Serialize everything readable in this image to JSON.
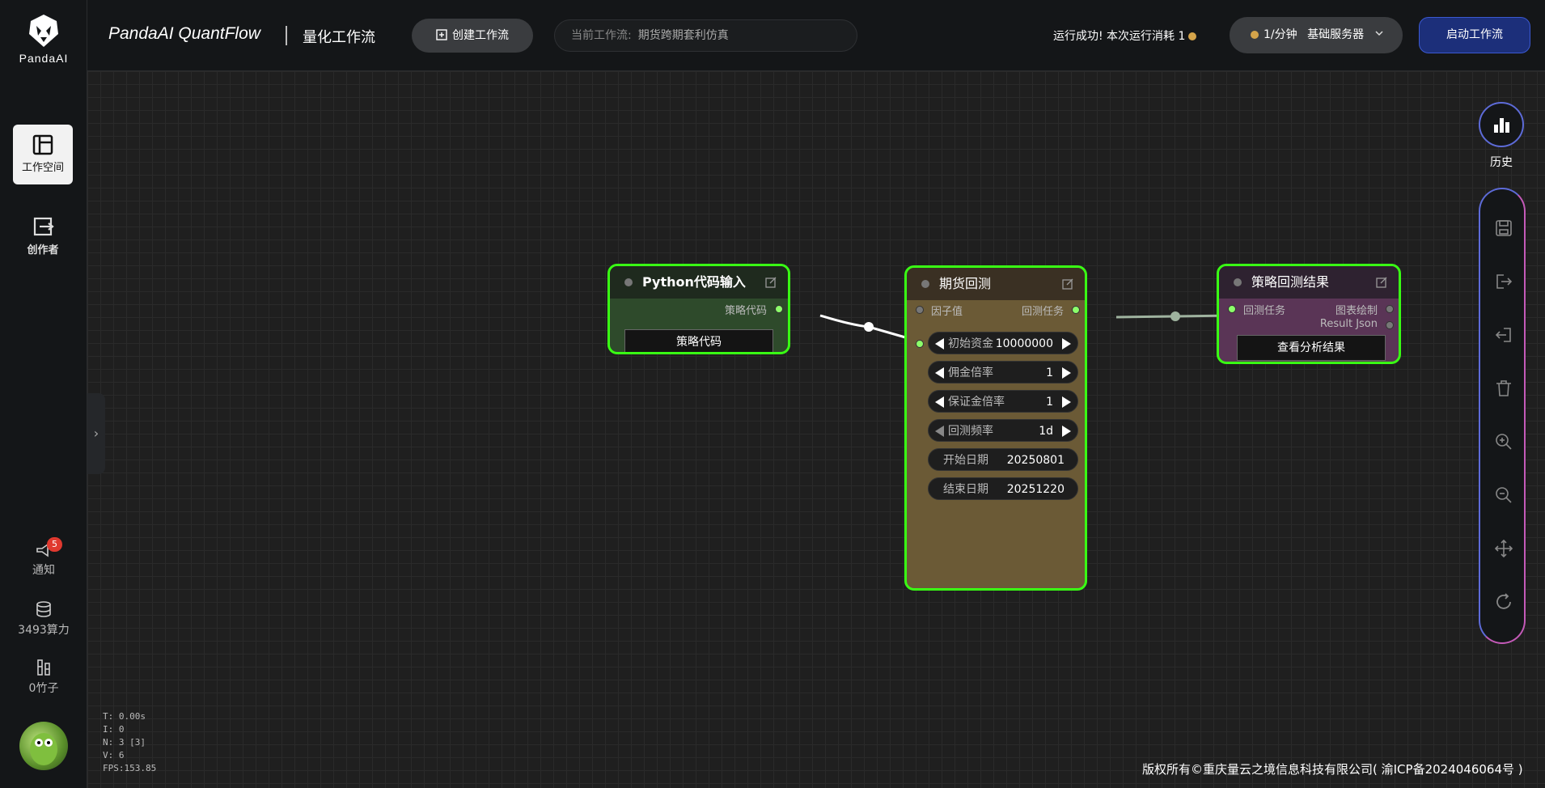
{
  "app": {
    "logo_text": "PandaAI",
    "brand": "PandaAI QuantFlow",
    "brand_sub": "量化工作流"
  },
  "sidebar": {
    "items": [
      {
        "label": "工作空间",
        "active": true
      },
      {
        "label": "创作者",
        "active": false
      }
    ],
    "notify_label": "通知",
    "notify_count": "5",
    "compute_label": "3493算力",
    "bamboo_label": "0竹子"
  },
  "header": {
    "create_label": "创建工作流",
    "current_flow_label": "当前工作流:",
    "current_flow_value": "期货跨期套利仿真",
    "run_status": "运行成功!  本次运行消耗 1",
    "server_rate": "1/分钟",
    "server_name": "基础服务器",
    "start_label": "启动工作流"
  },
  "nodes": {
    "python": {
      "title": "Python代码输入",
      "output": "策略代码",
      "button": "策略代码"
    },
    "backtest": {
      "title": "期货回测",
      "input_factor": "因子值",
      "output_task": "回测任务",
      "fields": [
        {
          "label": "初始资金",
          "value": "10000000"
        },
        {
          "label": "佣金倍率",
          "value": "1"
        },
        {
          "label": "保证金倍率",
          "value": "1"
        },
        {
          "label": "回测频率",
          "value": "1d"
        },
        {
          "label": "开始日期",
          "value": "20250801"
        },
        {
          "label": "结束日期",
          "value": "20251220"
        }
      ]
    },
    "result": {
      "title": "策略回测结果",
      "input_task": "回测任务",
      "output_chart": "图表绘制",
      "output_json": "Result Json",
      "button": "查看分析结果"
    }
  },
  "toolbar": {
    "history_label": "历史"
  },
  "stats": {
    "t": "T: 0.00s",
    "i": "I: 0",
    "n": "N: 3 [3]",
    "v": "V: 6",
    "fps": "FPS:153.85"
  },
  "footer": {
    "copyright": "版权所有©重庆量云之境信息科技有限公司( 渝ICP备2024046064号 )"
  },
  "colors": {
    "accent_green": "#39ff14",
    "python_node": "#2e4a2b",
    "backtest_node": "#6b5a36",
    "result_node": "#5a3556",
    "start_button": "#1c2f7a"
  }
}
